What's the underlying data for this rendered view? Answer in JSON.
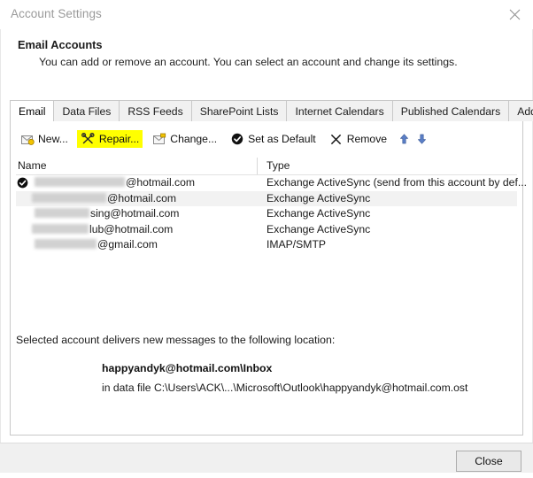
{
  "window": {
    "title": "Account Settings",
    "close_icon": "close-x-icon"
  },
  "header": {
    "title": "Email Accounts",
    "description": "You can add or remove an account. You can select an account and change its settings."
  },
  "tabs": [
    {
      "label": "Email",
      "active": true
    },
    {
      "label": "Data Files",
      "active": false
    },
    {
      "label": "RSS Feeds",
      "active": false
    },
    {
      "label": "SharePoint Lists",
      "active": false
    },
    {
      "label": "Internet Calendars",
      "active": false
    },
    {
      "label": "Published Calendars",
      "active": false
    },
    {
      "label": "Address Books",
      "active": false
    }
  ],
  "toolbar": {
    "items": [
      {
        "label": "New...",
        "icon": "new-mail-icon",
        "highlighted": false
      },
      {
        "label": "Repair...",
        "icon": "repair-tools-icon",
        "highlighted": true
      },
      {
        "label": "Change...",
        "icon": "change-account-icon",
        "highlighted": false
      },
      {
        "label": "Set as Default",
        "icon": "check-circle-icon",
        "highlighted": false
      },
      {
        "label": "Remove",
        "icon": "remove-x-icon",
        "highlighted": false
      }
    ],
    "move_up_icon": "arrow-up-icon",
    "move_down_icon": "arrow-down-icon",
    "highlight_color": "#ffff00"
  },
  "accounts_list": {
    "columns": [
      "Name",
      "Type"
    ],
    "rows": [
      {
        "name_redacted": true,
        "name_visible_suffix": "@hotmail.com",
        "type": "Exchange ActiveSync (send from this account by def...",
        "is_default": true,
        "selected": false
      },
      {
        "name_redacted": true,
        "name_visible_suffix": "@hotmail.com",
        "type": "Exchange ActiveSync",
        "is_default": false,
        "selected": true
      },
      {
        "name_redacted": true,
        "name_visible_suffix": "sing@hotmail.com",
        "type": "Exchange ActiveSync",
        "is_default": false,
        "selected": false
      },
      {
        "name_redacted": true,
        "name_visible_suffix": "lub@hotmail.com",
        "type": "Exchange ActiveSync",
        "is_default": false,
        "selected": false
      },
      {
        "name_redacted": true,
        "name_visible_suffix": "@gmail.com",
        "type": "IMAP/SMTP",
        "is_default": false,
        "selected": false
      }
    ]
  },
  "delivery": {
    "label": "Selected account delivers new messages to the following location:",
    "location": "happyandyk@hotmail.com\\Inbox",
    "data_file": "in data file C:\\Users\\ACK\\...\\Microsoft\\Outlook\\happyandyk@hotmail.com.ost"
  },
  "footer": {
    "close_label": "Close"
  }
}
